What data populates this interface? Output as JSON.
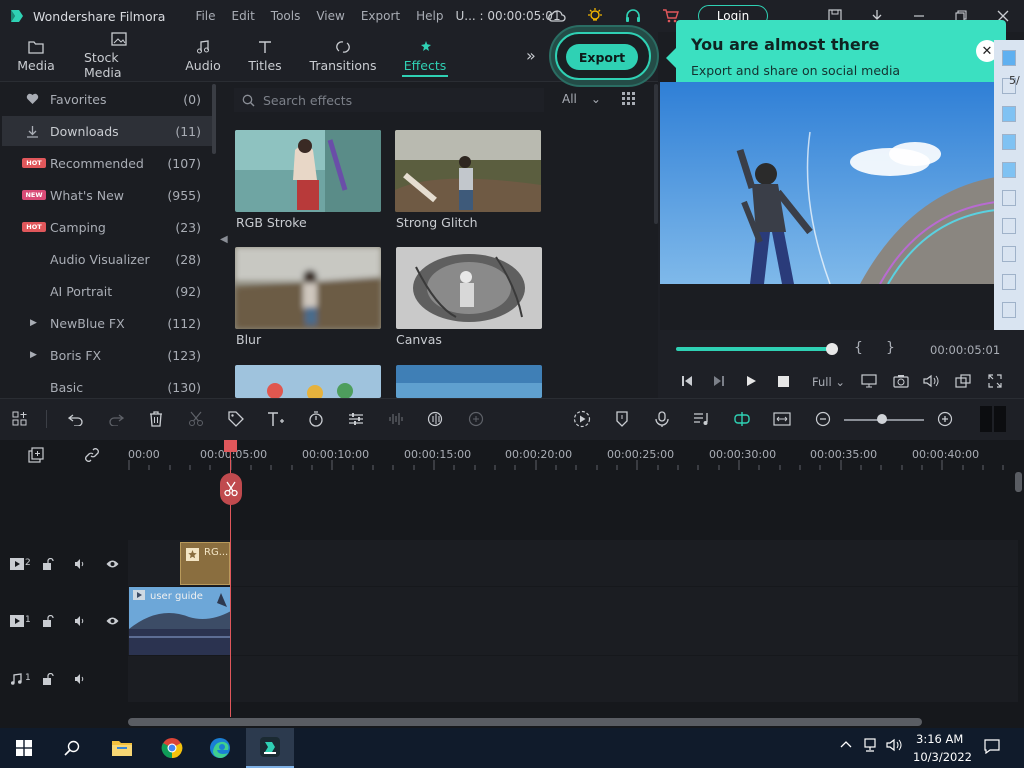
{
  "titlebar": {
    "app_name": "Wondershare Filmora",
    "menu": [
      "File",
      "Edit",
      "Tools",
      "View",
      "Export",
      "Help"
    ],
    "project": "U... : 00:00:05:01",
    "login_label": "Login"
  },
  "tabs": [
    {
      "label": "Media"
    },
    {
      "label": "Stock Media"
    },
    {
      "label": "Audio"
    },
    {
      "label": "Titles"
    },
    {
      "label": "Transitions"
    },
    {
      "label": "Effects"
    }
  ],
  "export": {
    "label": "Export",
    "tooltip_title": "You are almost there",
    "tooltip_sub": "Export and share on social media"
  },
  "sidebar": {
    "items": [
      {
        "label": "Favorites",
        "count": "(0)"
      },
      {
        "label": "Downloads",
        "count": "(11)"
      },
      {
        "label": "Recommended",
        "count": "(107)",
        "badge": "HOT"
      },
      {
        "label": "What's New",
        "count": "(955)",
        "badge": "NEW"
      },
      {
        "label": "Camping",
        "count": "(23)",
        "badge": "HOT"
      },
      {
        "label": "Audio Visualizer",
        "count": "(28)"
      },
      {
        "label": "AI Portrait",
        "count": "(92)"
      },
      {
        "label": "NewBlue FX",
        "count": "(112)"
      },
      {
        "label": "Boris FX",
        "count": "(123)"
      },
      {
        "label": "Basic",
        "count": "(130)"
      }
    ]
  },
  "effects": {
    "search_placeholder": "Search effects",
    "filter": "All",
    "items": [
      {
        "label": "RGB Stroke"
      },
      {
        "label": "Strong Glitch"
      },
      {
        "label": "Blur"
      },
      {
        "label": "Canvas"
      }
    ]
  },
  "preview": {
    "brace_open": "{",
    "brace_close": "}",
    "time": "00:00:05:01",
    "quality": "Full",
    "film_number": "5/"
  },
  "timeline": {
    "ruler": [
      "00:00",
      "00:00:05:00",
      "00:00:10:00",
      "00:00:15:00",
      "00:00:20:00",
      "00:00:25:00",
      "00:00:30:00",
      "00:00:35:00",
      "00:00:40:00"
    ],
    "tracks": [
      {
        "num": "2"
      },
      {
        "num": "1"
      },
      {
        "num": "1"
      }
    ],
    "effect_clip_label": "RG...",
    "video_clip_label": "user guide"
  },
  "taskbar": {
    "time": "3:16 AM",
    "date": "10/3/2022"
  },
  "colors": {
    "accent": "#2fd1b4",
    "tooltip": "#3be0c1",
    "playhead": "#e0575b",
    "background": "#1b1d22"
  }
}
